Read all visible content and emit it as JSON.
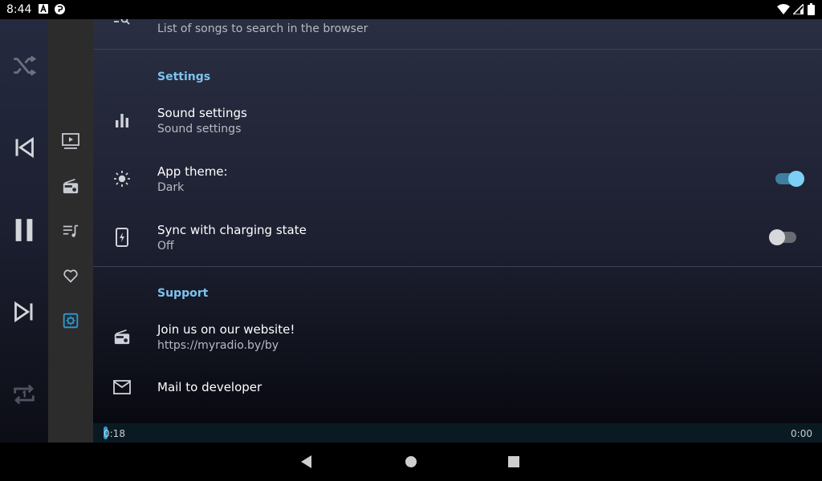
{
  "status": {
    "time": "8:44"
  },
  "list_item_top": {
    "subtitle": "List of songs to search in the browser"
  },
  "settings": {
    "header": "Settings",
    "sound": {
      "title": "Sound settings",
      "subtitle": "Sound settings"
    },
    "theme": {
      "title": "App theme:",
      "subtitle": "Dark",
      "enabled": true
    },
    "sync": {
      "title": "Sync with charging state",
      "subtitle": "Off",
      "enabled": false
    }
  },
  "support": {
    "header": "Support",
    "website": {
      "title": "Join us on our website!",
      "subtitle": "https://myradio.by/by"
    },
    "mail": {
      "title": "Mail to developer"
    }
  },
  "progress": {
    "elapsed": "0:18",
    "duration": "0:00"
  },
  "colors": {
    "accent": "#2a9bd6",
    "section_header": "#7cc4ee",
    "switch_on": "#7dd0f5"
  }
}
